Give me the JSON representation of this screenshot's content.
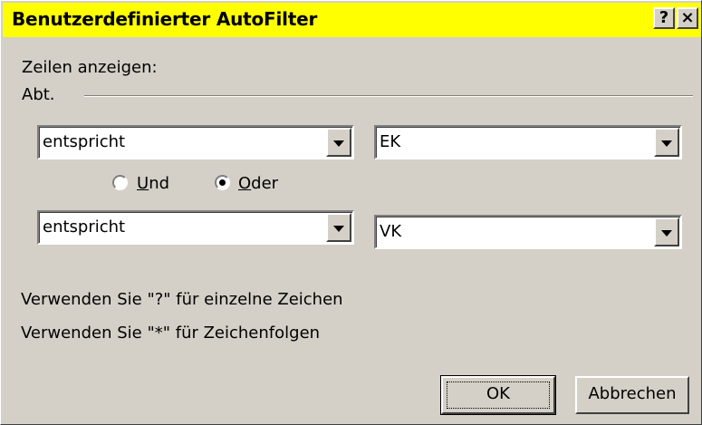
{
  "window": {
    "title": "Benutzerdefinierter AutoFilter",
    "help_button": "?",
    "close_button": "×"
  },
  "filter": {
    "show_rows_label": "Zeilen anzeigen:",
    "field_label": "Abt.",
    "condition1": {
      "operator": "entspricht",
      "value": "EK"
    },
    "condition2": {
      "operator": "entspricht",
      "value": "VK"
    },
    "logic": {
      "and_label_rest": "nd",
      "and_label_mnemonic": "U",
      "or_label_rest": "der",
      "or_label_mnemonic": "O",
      "selected": "Oder"
    }
  },
  "hints": {
    "single_char": "Verwenden Sie \"?\" für einzelne Zeichen",
    "char_sequence": "Verwenden Sie \"*\" für Zeichenfolgen"
  },
  "buttons": {
    "ok": "OK",
    "cancel": "Abbrechen"
  },
  "colors": {
    "title_bar": "#ffff00",
    "dialog_face": "#d4d0c8"
  }
}
